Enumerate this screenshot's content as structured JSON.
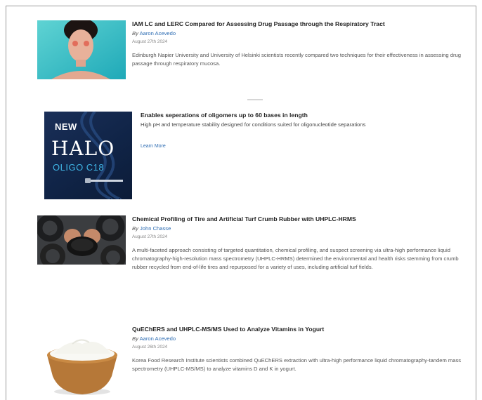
{
  "articles": [
    {
      "title": "IAM LC and LERC Compared for Assessing Drug Passage through the Respiratory Tract",
      "by": "By",
      "author": "Aaron Acevedo",
      "date": "August 27th 2024",
      "summary": "Edinburgh Napier University and University of Helsinki scientists recently compared two techniques for their effectiveness in assessing drug passage through respiratory mucosa."
    },
    {
      "title": "Chemical Profiling of Tire and Artificial Turf Crumb Rubber with UHPLC-HRMS",
      "by": "By",
      "author": "John Chasse",
      "date": "August 27th 2024",
      "summary": "A multi-faceted approach consisting of targeted quantitation, chemical profiling, and suspect screening via ultra-high performance liquid chromatography-high-resolution mass spectrometry (UHPLC-HRMS) determined the environmental and health risks stemming from crumb rubber recycled from end-of-life tires and repurposed for a variety of uses, including artificial turf fields."
    },
    {
      "title": "QuEChERS and UHPLC-MS/MS Used to Analyze Vitamins in Yogurt",
      "by": "By",
      "author": "Aaron Acevedo",
      "date": "August 26th 2024",
      "summary": "Korea Food Research Institute scientists combined QuEChERS extraction with ultra-high performance liquid chromatography-tandem mass spectrometry (UHPLC-MS/MS) to analyze vitamins D and K in yogurt."
    }
  ],
  "ad": {
    "badge": "NEW",
    "brand": "HALO",
    "subline": "OLIGO C18",
    "title": "Enables seperations of oligomers up to 60 bases in length",
    "description": "High pH and temperature stability designed for conditions suited for oligonucleotide separations",
    "link": "Learn More"
  }
}
